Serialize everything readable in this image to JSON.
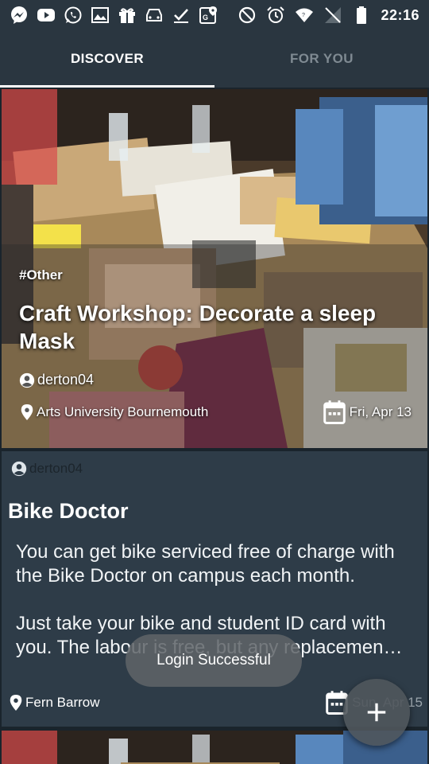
{
  "status_bar": {
    "time": "22:16",
    "left_icons": [
      "messenger-icon",
      "youtube-icon",
      "whatsapp-icon",
      "image-icon",
      "gift-icon",
      "car-icon",
      "check-icon",
      "google-maps-icon"
    ],
    "right_icons": [
      "do-not-disturb-icon",
      "alarm-icon",
      "wifi-icon",
      "no-sim-icon",
      "battery-icon"
    ]
  },
  "tabs": [
    {
      "label": "DISCOVER",
      "active": true
    },
    {
      "label": "FOR YOU",
      "active": false
    }
  ],
  "cards": {
    "featured": {
      "tag": "#Other",
      "title": "Craft Workshop: Decorate a sleep Mask",
      "author": "derton04",
      "location": "Arts University Bournemouth",
      "date": "Fri, Apr 13"
    },
    "second": {
      "author": "derton04",
      "title": "Bike Doctor",
      "description": "You can get bike serviced free of charge with the Bike Doctor on campus each month.\n\nJust take your bike and student ID card with you. The labour is free, but any replacemen…",
      "location": "Fern Barrow",
      "date": "Sun, Apr 15"
    }
  },
  "toast": {
    "message": "Login Successful"
  },
  "fab": {
    "icon": "plus-icon"
  },
  "colors": {
    "app_bar": "#2a3640",
    "card_bg": "#2e3c48",
    "indicator": "#ffffff",
    "inactive_tab": "#7f8a92"
  }
}
